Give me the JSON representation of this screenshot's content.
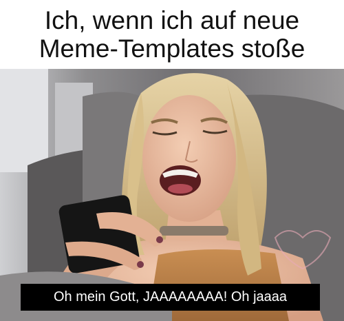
{
  "caption": {
    "line1": "Ich, wenn ich auf neue",
    "line2": "Meme-Templates stoße"
  },
  "photo": {
    "subject": "woman-looking-at-phone-screaming"
  },
  "subtitle": {
    "text": "Oh mein Gott, JAAAAAAAA! Oh jaaaa"
  },
  "colors": {
    "background": "#ffffff",
    "caption_text": "#111111",
    "subtitle_bg": "#000000",
    "subtitle_text": "#ffffff"
  }
}
